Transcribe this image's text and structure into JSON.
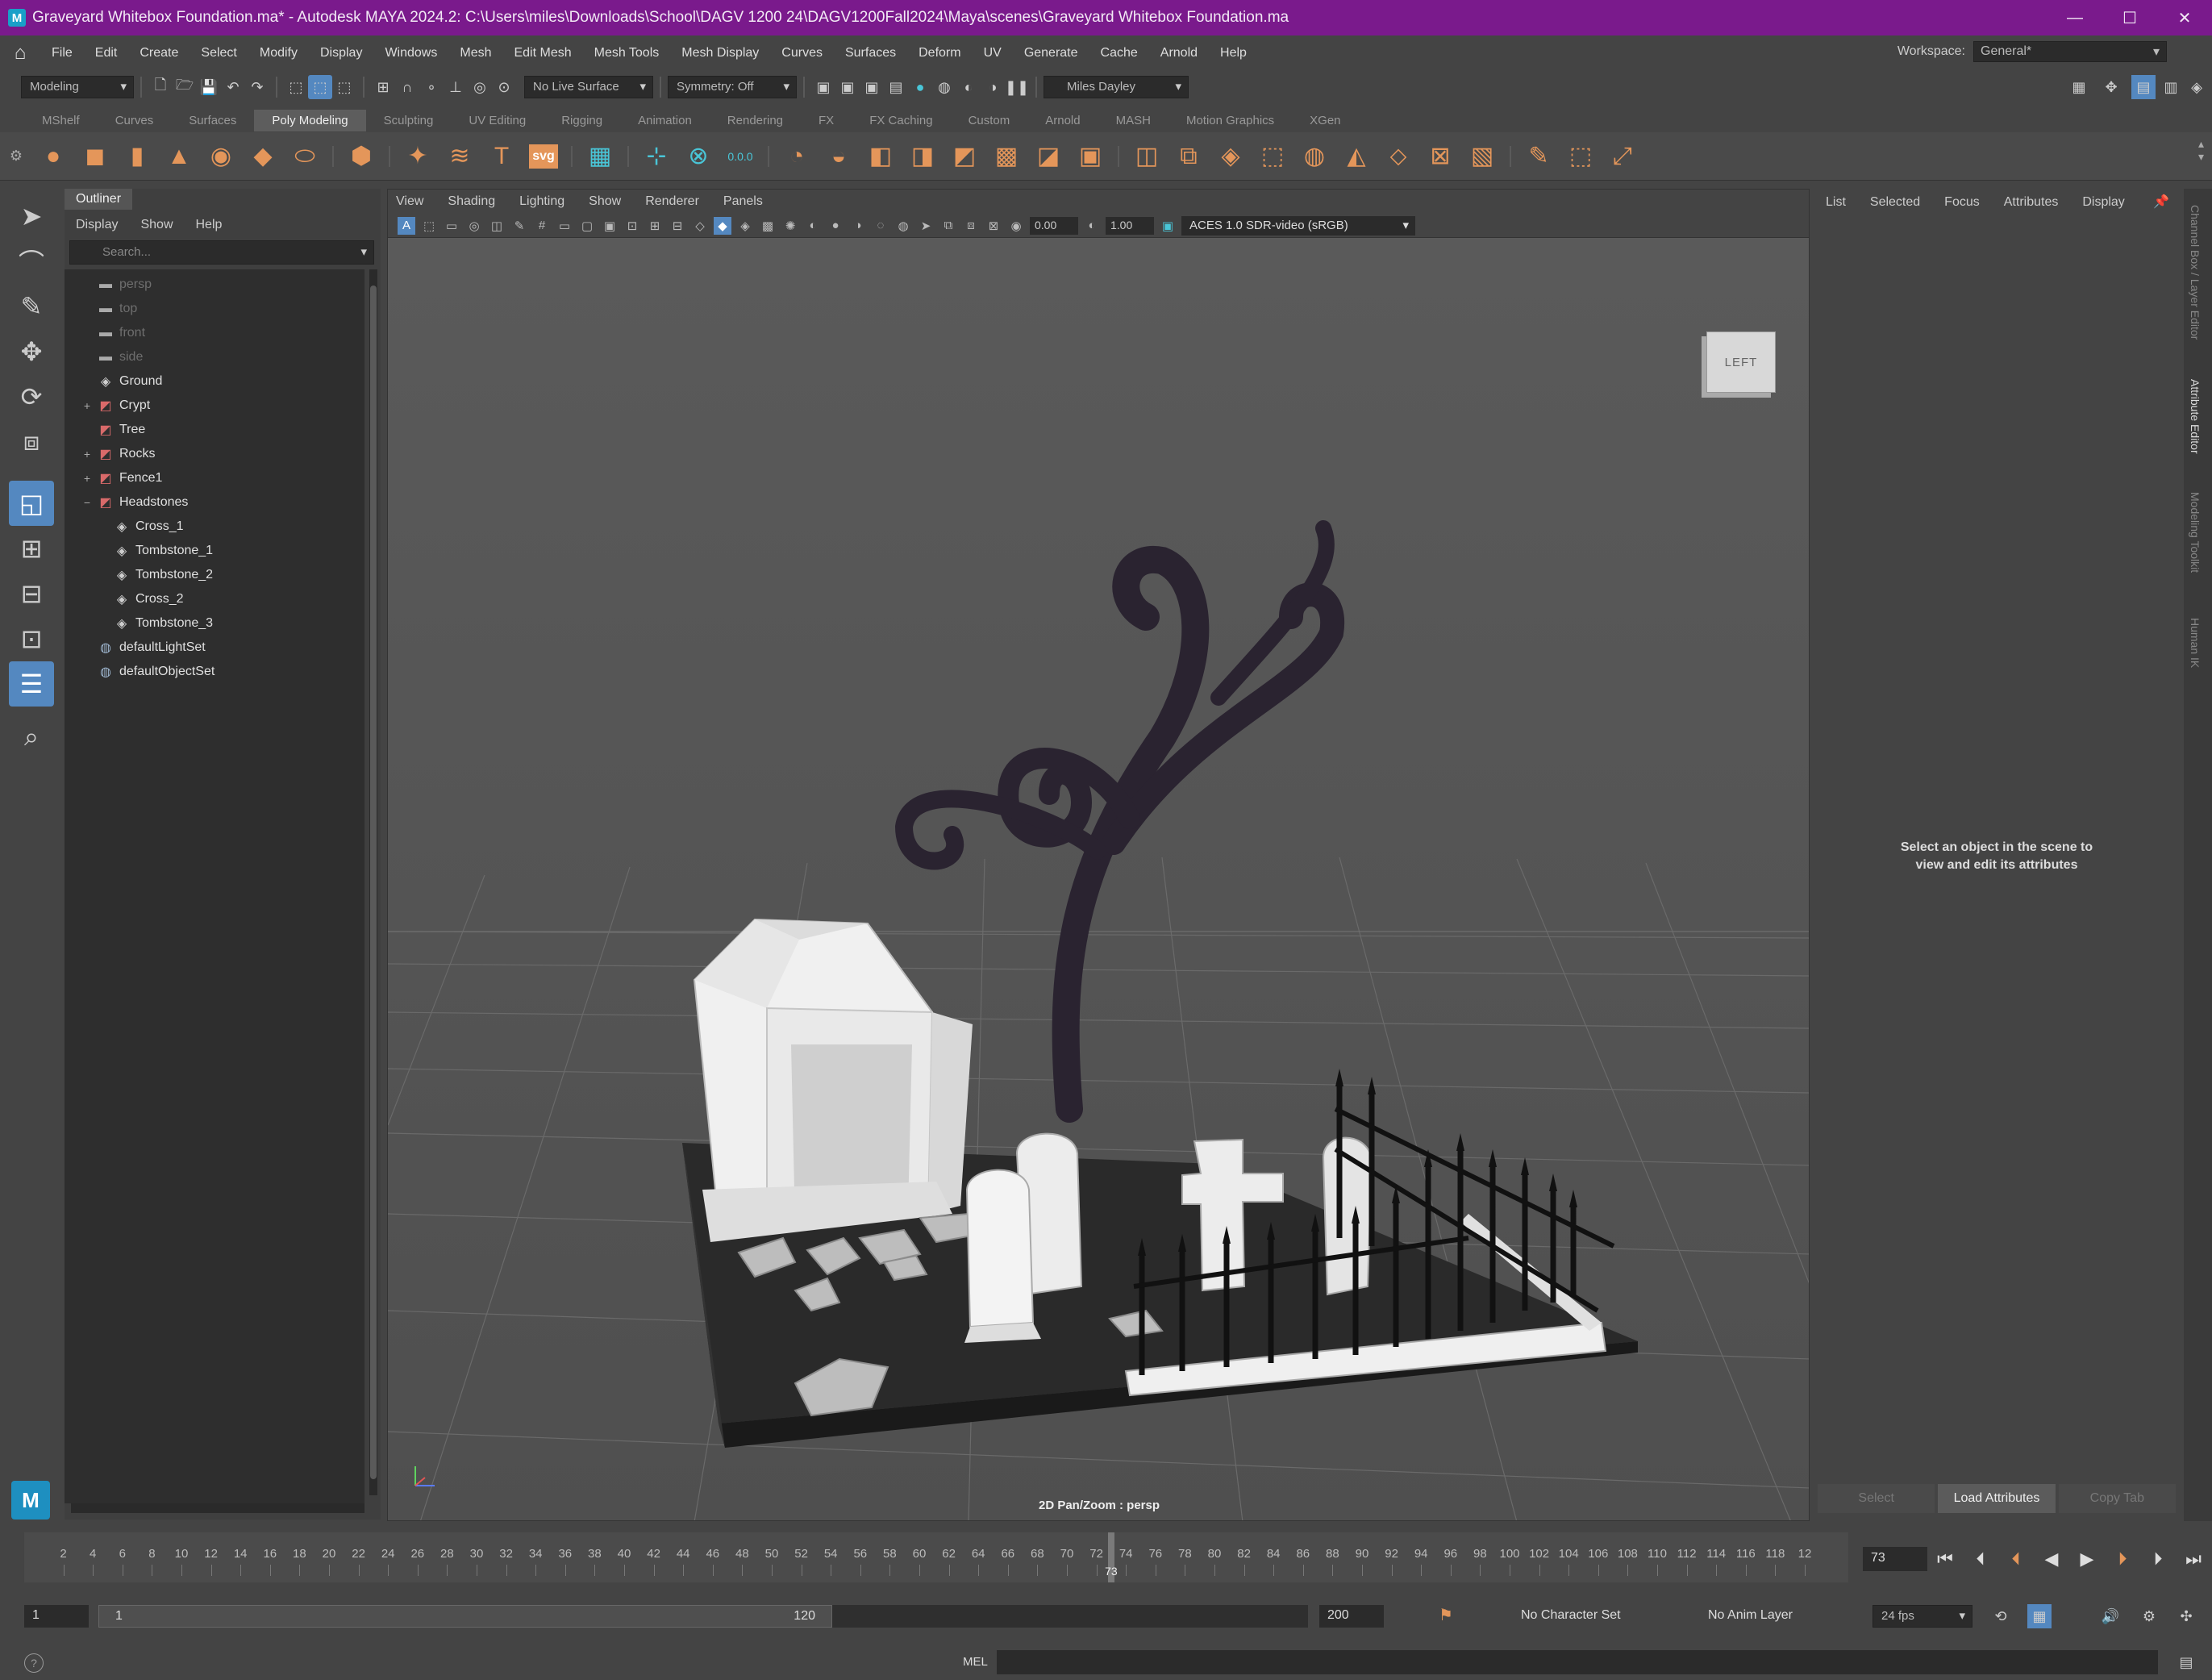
{
  "window": {
    "title": "Graveyard Whitebox Foundation.ma* - Autodesk MAYA 2024.2: C:\\Users\\miles\\Downloads\\School\\DAGV 1200 24\\DAGV1200Fall2024\\Maya\\scenes\\Graveyard Whitebox Foundation.ma",
    "app_badge": "M"
  },
  "menubar": {
    "items": [
      "File",
      "Edit",
      "Create",
      "Select",
      "Modify",
      "Display",
      "Windows",
      "Mesh",
      "Edit Mesh",
      "Mesh Tools",
      "Mesh Display",
      "Curves",
      "Surfaces",
      "Deform",
      "UV",
      "Generate",
      "Cache",
      "Arnold",
      "Help"
    ],
    "workspace_label": "Workspace:",
    "workspace_value": "General*"
  },
  "statusline": {
    "mode": "Modeling",
    "live_surface": "No Live Surface",
    "symmetry": "Symmetry: Off",
    "user": "Miles Dayley"
  },
  "shelf": {
    "tabs": [
      "MShelf",
      "Curves",
      "Surfaces",
      "Poly Modeling",
      "Sculpting",
      "UV Editing",
      "Rigging",
      "Animation",
      "Rendering",
      "FX",
      "FX Caching",
      "Custom",
      "Arnold",
      "MASH",
      "Motion Graphics",
      "XGen"
    ],
    "active_tab": "Poly Modeling",
    "svg_label": "svg",
    "snap_value": "0.0.0"
  },
  "outliner": {
    "title": "Outliner",
    "menu": [
      "Display",
      "Show",
      "Help"
    ],
    "search_placeholder": "Search...",
    "items": [
      {
        "label": "persp",
        "dim": true,
        "icon": "camera-icon",
        "depth": 0,
        "expander": ""
      },
      {
        "label": "top",
        "dim": true,
        "icon": "camera-icon",
        "depth": 0,
        "expander": ""
      },
      {
        "label": "front",
        "dim": true,
        "icon": "camera-icon",
        "depth": 0,
        "expander": ""
      },
      {
        "label": "side",
        "dim": true,
        "icon": "camera-icon",
        "depth": 0,
        "expander": ""
      },
      {
        "label": "Ground",
        "dim": false,
        "icon": "mesh-icon",
        "depth": 0,
        "expander": ""
      },
      {
        "label": "Crypt",
        "dim": false,
        "icon": "group-icon",
        "depth": 0,
        "expander": "+"
      },
      {
        "label": "Tree",
        "dim": false,
        "icon": "group-icon",
        "depth": 0,
        "expander": ""
      },
      {
        "label": "Rocks",
        "dim": false,
        "icon": "group-icon",
        "depth": 0,
        "expander": "+"
      },
      {
        "label": "Fence1",
        "dim": false,
        "icon": "group-icon",
        "depth": 0,
        "expander": "+"
      },
      {
        "label": "Headstones",
        "dim": false,
        "icon": "group-icon",
        "depth": 0,
        "expander": "−"
      },
      {
        "label": "Cross_1",
        "dim": false,
        "icon": "mesh-icon",
        "depth": 1,
        "expander": ""
      },
      {
        "label": "Tombstone_1",
        "dim": false,
        "icon": "mesh-icon",
        "depth": 1,
        "expander": ""
      },
      {
        "label": "Tombstone_2",
        "dim": false,
        "icon": "mesh-icon",
        "depth": 1,
        "expander": ""
      },
      {
        "label": "Cross_2",
        "dim": false,
        "icon": "mesh-icon",
        "depth": 1,
        "expander": ""
      },
      {
        "label": "Tombstone_3",
        "dim": false,
        "icon": "mesh-icon",
        "depth": 1,
        "expander": ""
      },
      {
        "label": "defaultLightSet",
        "dim": false,
        "icon": "set-icon",
        "depth": 0,
        "expander": ""
      },
      {
        "label": "defaultObjectSet",
        "dim": false,
        "icon": "set-icon",
        "depth": 0,
        "expander": ""
      }
    ]
  },
  "viewport": {
    "menu": [
      "View",
      "Shading",
      "Lighting",
      "Show",
      "Renderer",
      "Panels"
    ],
    "exposure": "0.00",
    "gamma": "1.00",
    "color_space": "ACES 1.0 SDR-video (sRGB)",
    "viewcube_label": "LEFT",
    "camera_label": "2D Pan/Zoom : persp"
  },
  "attribute_editor": {
    "tabs": [
      "List",
      "Selected",
      "Focus",
      "Attributes",
      "Display"
    ],
    "empty_message_line1": "Select an object in the scene to",
    "empty_message_line2": "view and edit its attributes",
    "buttons": [
      "Select",
      "Load Attributes",
      "Copy Tab"
    ]
  },
  "side_tabs": [
    "Channel Box / Layer Editor",
    "Attribute Editor",
    "Modeling Toolkit",
    "Human IK"
  ],
  "timeline": {
    "ticks": [
      "2",
      "4",
      "6",
      "8",
      "10",
      "12",
      "14",
      "16",
      "18",
      "20",
      "22",
      "24",
      "26",
      "28",
      "30",
      "32",
      "34",
      "36",
      "38",
      "40",
      "42",
      "44",
      "46",
      "48",
      "50",
      "52",
      "54",
      "56",
      "58",
      "60",
      "62",
      "64",
      "66",
      "68",
      "70",
      "72",
      "74",
      "76",
      "78",
      "80",
      "82",
      "84",
      "86",
      "88",
      "90",
      "92",
      "94",
      "96",
      "98",
      "100",
      "102",
      "104",
      "106",
      "108",
      "110",
      "112",
      "114",
      "116",
      "118",
      "12"
    ],
    "current_frame": "73",
    "current_frame_field": "73"
  },
  "range": {
    "start": "1",
    "inner_start": "1",
    "inner_end": "120",
    "end": "200",
    "character_set": "No Character Set",
    "anim_layer": "No Anim Layer",
    "fps": "24 fps"
  },
  "cmdline": {
    "lang": "MEL"
  },
  "colors": {
    "titlebar": "#7a1a8c",
    "shelf_icon": "#e4965a",
    "accent": "#5488c0"
  }
}
